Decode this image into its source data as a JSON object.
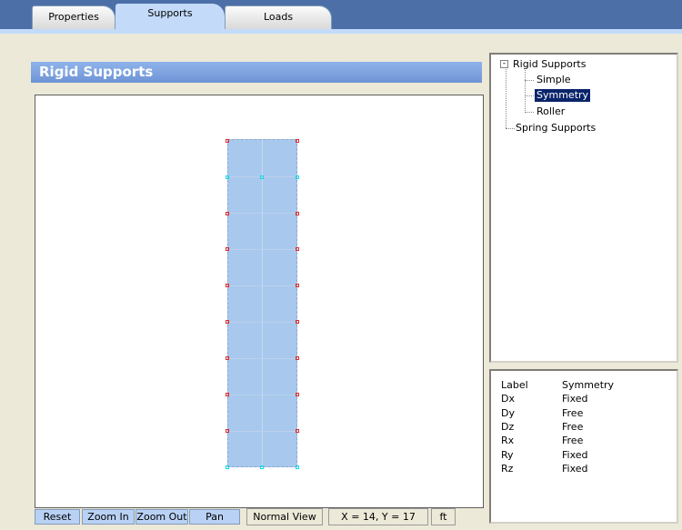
{
  "tabs": [
    {
      "label": "Properties"
    },
    {
      "label": "Supports"
    },
    {
      "label": "Loads"
    }
  ],
  "active_tab": "Supports",
  "panel": {
    "title": "Rigid Supports"
  },
  "toolbar": {
    "reset_label": "Reset",
    "zoom_in_label": "Zoom In",
    "zoom_out_label": "Zoom Out",
    "pan_label": "Pan",
    "view_mode": "Normal View",
    "coordinates": "X = 14, Y = 17",
    "units": "ft"
  },
  "tree": {
    "root": {
      "label": "Rigid Supports",
      "expander": "-"
    },
    "children": [
      {
        "label": "Simple"
      },
      {
        "label": "Symmetry"
      },
      {
        "label": "Roller"
      }
    ],
    "selected": "Symmetry",
    "spring": {
      "label": "Spring Supports"
    }
  },
  "properties": [
    {
      "key": "Label",
      "value": "Symmetry"
    },
    {
      "key": "Dx",
      "value": "Fixed"
    },
    {
      "key": "Dy",
      "value": "Free"
    },
    {
      "key": "Dz",
      "value": "Free"
    },
    {
      "key": "Rx",
      "value": "Free"
    },
    {
      "key": "Ry",
      "value": "Fixed"
    },
    {
      "key": "Rz",
      "value": "Fixed"
    }
  ],
  "colors": {
    "tab_bar": "#4d6fa8",
    "header": "#7fa3e0",
    "member_fill": "#a8c8ee",
    "support_node": "#e0282c",
    "symmetry_node": "#14d9e6",
    "selection": "#0a246a"
  }
}
